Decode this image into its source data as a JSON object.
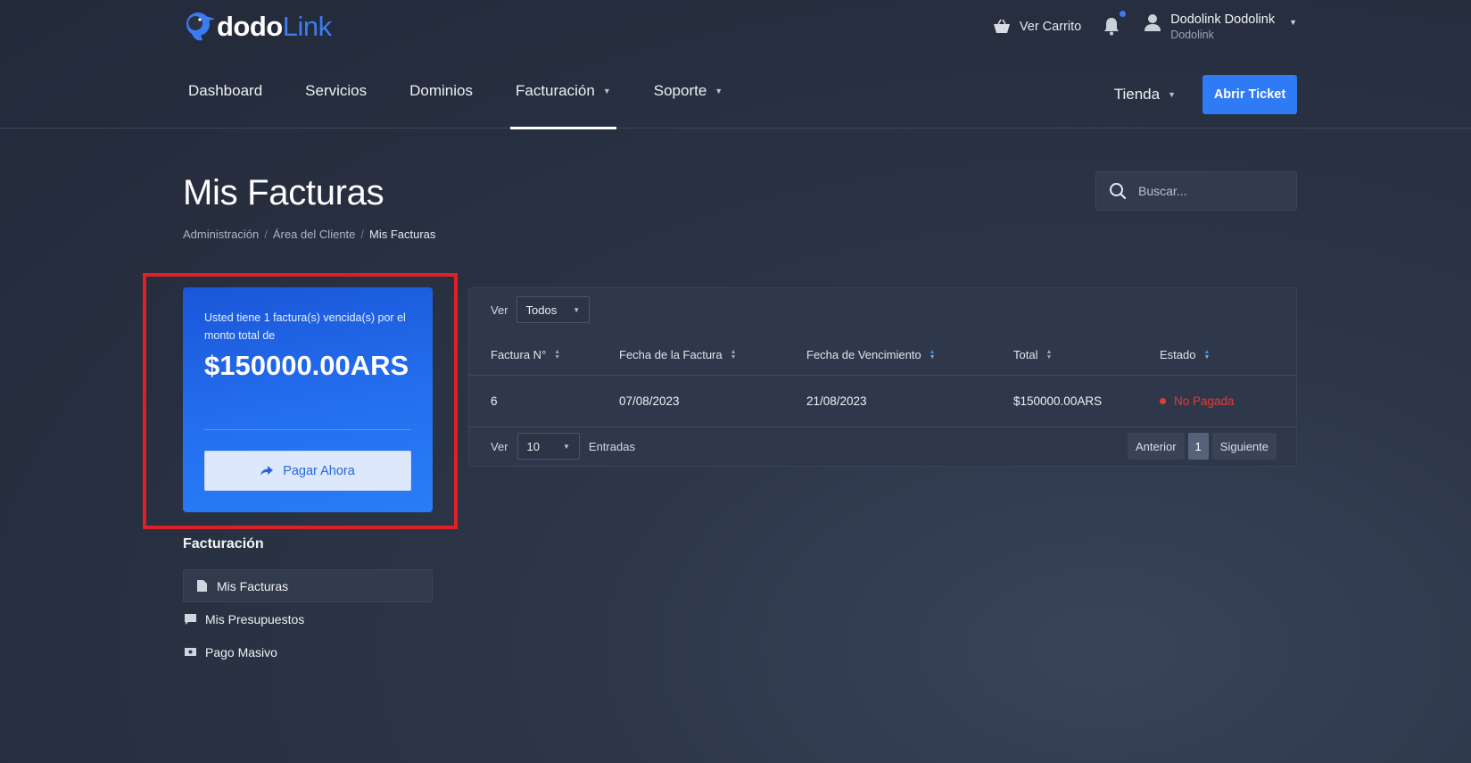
{
  "brand": {
    "name_part1": "dodo",
    "name_part2": "Link",
    "accent": "#3d7bf2"
  },
  "topbar": {
    "cart_label": "Ver Carrito",
    "cart_icon": "basket-icon",
    "bell_icon": "bell-icon",
    "user_name": "Dodolink Dodolink",
    "user_company": "Dodolink"
  },
  "nav": {
    "items": [
      {
        "label": "Dashboard",
        "dropdown": false,
        "active": false
      },
      {
        "label": "Servicios",
        "dropdown": false,
        "active": false
      },
      {
        "label": "Dominios",
        "dropdown": false,
        "active": false
      },
      {
        "label": "Facturación",
        "dropdown": true,
        "active": true
      },
      {
        "label": "Soporte",
        "dropdown": true,
        "active": false
      }
    ],
    "store_label": "Tienda",
    "ticket_button": "Abrir Ticket"
  },
  "page": {
    "title": "Mis Facturas",
    "breadcrumb": [
      "Administración",
      "Área del Cliente",
      "Mis Facturas"
    ],
    "search_placeholder": "Buscar..."
  },
  "due_card": {
    "message": "Usted tiene 1 factura(s) vencida(s) por el monto total de",
    "amount": "$150000.00ARS",
    "pay_button": "Pagar Ahora"
  },
  "sidebar": {
    "heading": "Facturación",
    "items": [
      {
        "label": "Mis Facturas",
        "icon": "document-icon",
        "active": true
      },
      {
        "label": "Mis Presupuestos",
        "icon": "comment-icon",
        "active": false
      },
      {
        "label": "Pago Masivo",
        "icon": "money-icon",
        "active": false
      }
    ]
  },
  "table": {
    "filter_label": "Ver",
    "filter_value": "Todos",
    "columns": [
      "Factura N°",
      "Fecha de la Factura",
      "Fecha de Vencimiento",
      "Total",
      "Estado"
    ],
    "rows": [
      {
        "number": "6",
        "date": "07/08/2023",
        "due": "21/08/2023",
        "total": "$150000.00ARS",
        "status": "No Pagada",
        "status_color": "#e53a3a"
      }
    ],
    "footer": {
      "show_label": "Ver",
      "page_size": "10",
      "entries_label": "Entradas",
      "prev": "Anterior",
      "current_page": "1",
      "next": "Siguiente"
    }
  }
}
